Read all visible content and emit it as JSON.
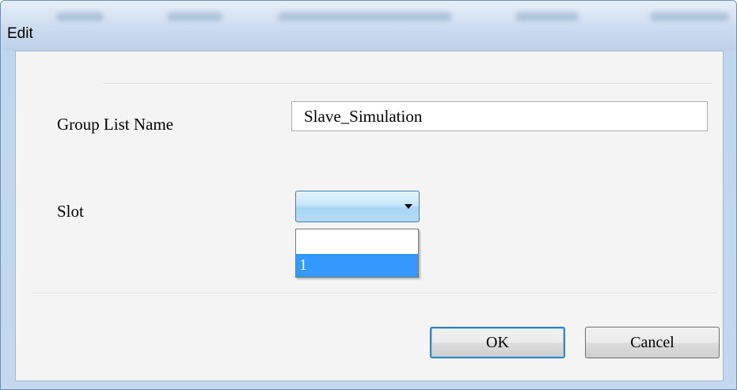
{
  "window": {
    "title": "Edit"
  },
  "form": {
    "group_list_name_label": "Group List Name",
    "group_list_name_value": "Slave_Simulation",
    "slot_label": "Slot",
    "slot_selected_value": "",
    "slot_options": [
      "",
      "1"
    ],
    "slot_highlighted_option": "1"
  },
  "buttons": {
    "ok_label": "OK",
    "cancel_label": "Cancel"
  },
  "colors": {
    "selection_highlight": "#3399ff",
    "focus_border": "#3c7fb1"
  }
}
